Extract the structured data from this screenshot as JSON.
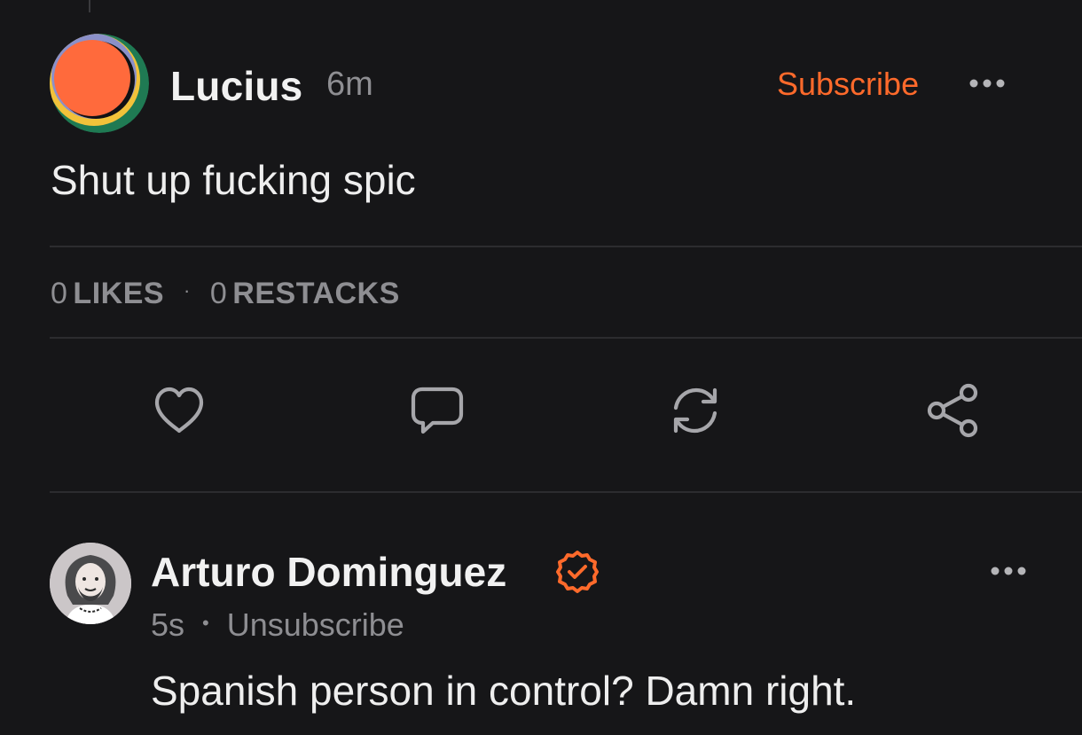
{
  "post": {
    "author": "Lucius",
    "time": "6m",
    "subscribe_label": "Subscribe",
    "body": "Shut up fucking spic",
    "likes_count": "0",
    "likes_label": "LIKES",
    "restacks_count": "0",
    "restacks_label": "RESTACKS",
    "stats_separator": "·"
  },
  "reply": {
    "author": "Arturo Dominguez",
    "time": "5s",
    "separator": "•",
    "unsubscribe_label": "Unsubscribe",
    "body": "Spanish person in control? Damn right."
  },
  "icons": {
    "more": "more-horizontal-icon",
    "like": "heart-icon",
    "comment": "comment-icon",
    "restack": "restack-icon",
    "share": "share-icon",
    "verified": "verified-badge-icon"
  },
  "colors": {
    "background": "#161618",
    "accent": "#ff6a2b",
    "muted": "#8e8e92",
    "text": "#eeeeee"
  }
}
